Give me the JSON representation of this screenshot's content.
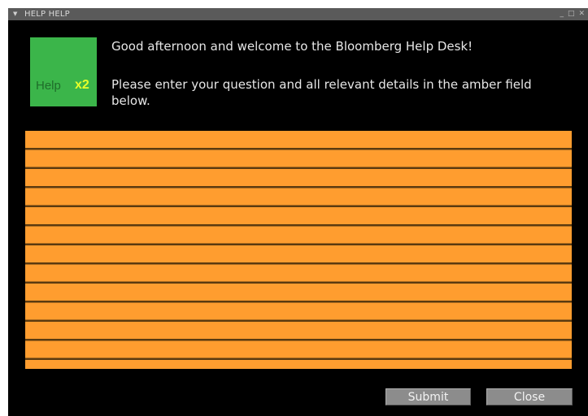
{
  "window": {
    "title": "HELP HELP",
    "controls": {
      "minimize": "_",
      "maximize": "□",
      "close": "✕"
    }
  },
  "logo": {
    "text": "Help",
    "badge": "x2",
    "background_color": "#3bb54a",
    "badge_color": "#e7ff2a"
  },
  "content": {
    "greeting": "Good afternoon and welcome to the Bloomberg Help Desk!",
    "instructions": "Please enter your question and all relevant details in the amber field below."
  },
  "question_field": {
    "value": "",
    "color": "#ff9d2f"
  },
  "buttons": {
    "submit": "Submit",
    "close": "Close"
  }
}
